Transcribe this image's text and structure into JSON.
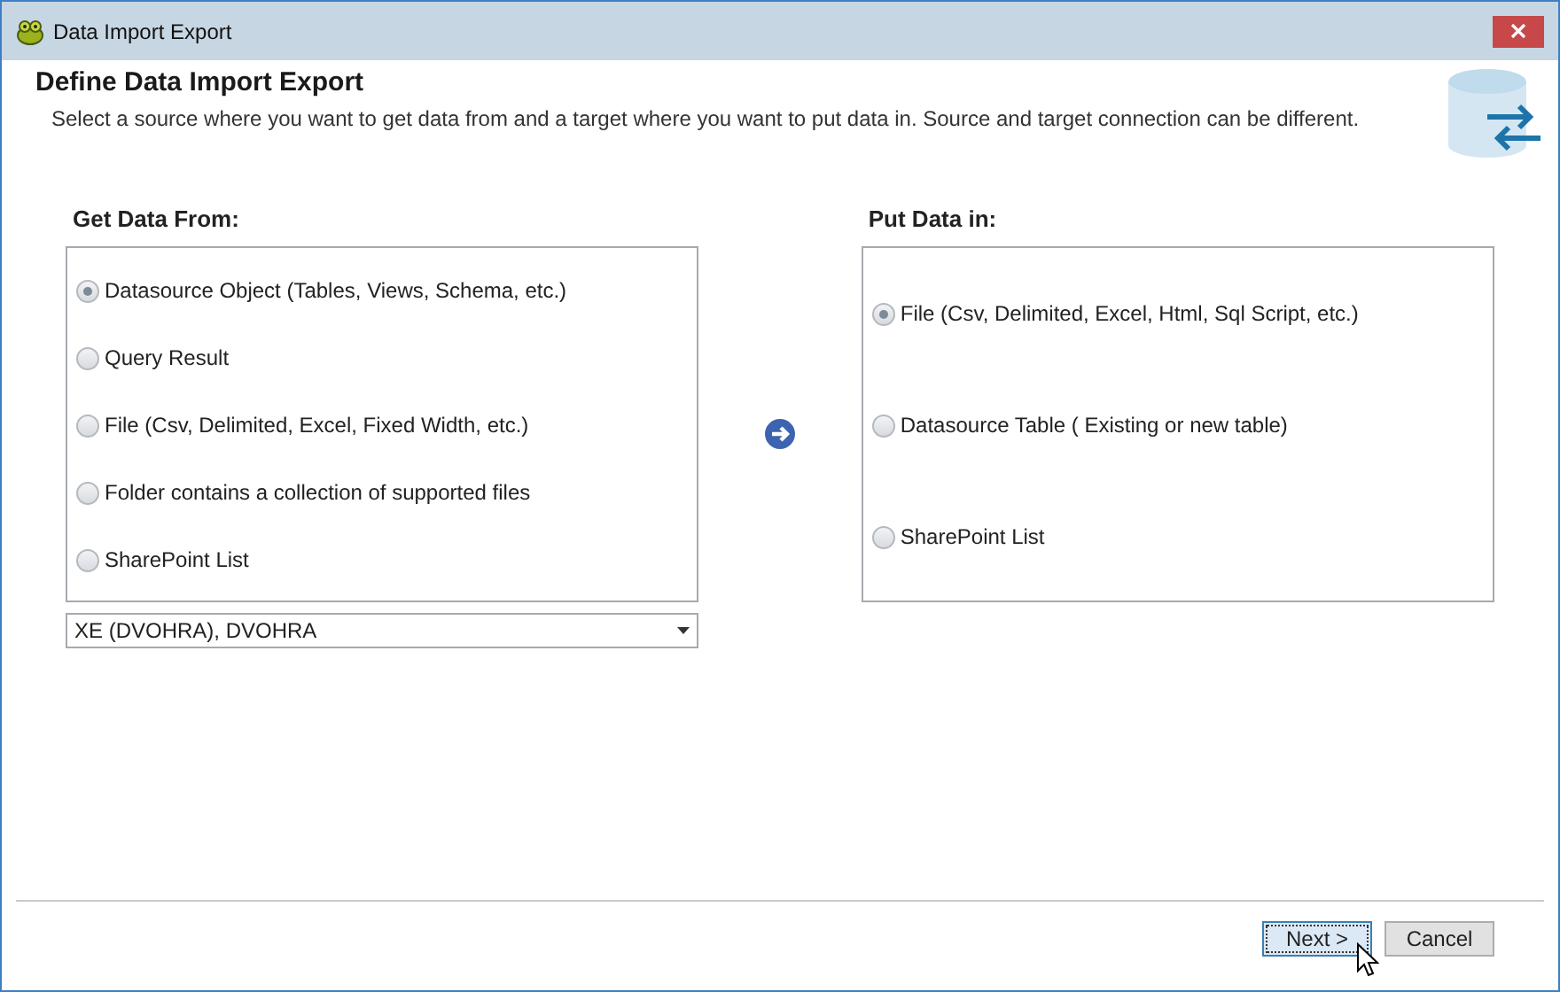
{
  "window": {
    "title": "Data Import Export"
  },
  "header": {
    "title": "Define Data Import Export",
    "description": "Select a source where you want to get data from and a target where you want to put data in. Source and target connection can be different."
  },
  "source": {
    "label": "Get Data From:",
    "options": [
      {
        "label": "Datasource Object (Tables, Views, Schema, etc.)",
        "selected": true
      },
      {
        "label": "Query Result",
        "selected": false
      },
      {
        "label": "File (Csv, Delimited, Excel, Fixed Width, etc.)",
        "selected": false
      },
      {
        "label": "Folder contains a collection of supported files",
        "selected": false
      },
      {
        "label": "SharePoint List",
        "selected": false
      }
    ],
    "connection": {
      "value": "XE (DVOHRA), DVOHRA"
    }
  },
  "target": {
    "label": "Put Data in:",
    "options": [
      {
        "label": "File (Csv, Delimited, Excel, Html, Sql Script, etc.)",
        "selected": true
      },
      {
        "label": "Datasource Table ( Existing or new table)",
        "selected": false
      },
      {
        "label": "SharePoint List",
        "selected": false
      }
    ]
  },
  "buttons": [
    {
      "label": "Next >",
      "focused": true
    },
    {
      "label": "Cancel",
      "focused": false
    }
  ]
}
